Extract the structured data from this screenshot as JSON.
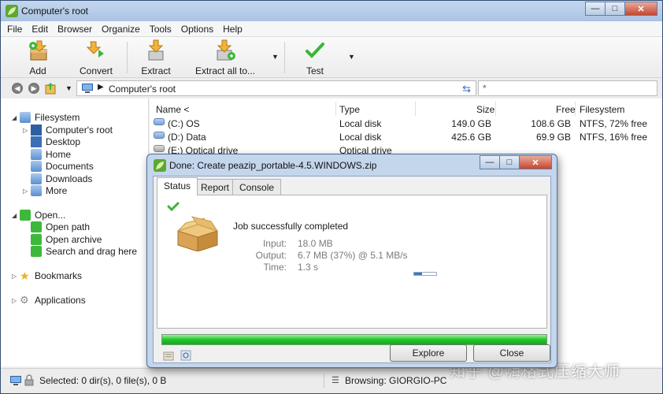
{
  "window": {
    "title": "Computer's root"
  },
  "menu": [
    "File",
    "Edit",
    "Browser",
    "Organize",
    "Tools",
    "Options",
    "Help"
  ],
  "toolbar": {
    "add": "Add",
    "convert": "Convert",
    "extract": "Extract",
    "extract_all": "Extract all to...",
    "test": "Test"
  },
  "address": {
    "path": "Computer's root",
    "filter_placeholder": "*"
  },
  "sidebar": {
    "filesystem": "Filesystem",
    "computers_root": "Computer's root",
    "desktop": "Desktop",
    "home": "Home",
    "documents": "Documents",
    "downloads": "Downloads",
    "more": "More",
    "open": "Open...",
    "open_path": "Open path",
    "open_archive": "Open archive",
    "search_drag": "Search and drag here",
    "bookmarks": "Bookmarks",
    "applications": "Applications"
  },
  "filelist": {
    "columns": {
      "name": "Name <",
      "type": "Type",
      "size": "Size",
      "free": "Free",
      "filesystem": "Filesystem"
    },
    "rows": [
      {
        "name": "(C:) OS",
        "type": "Local disk",
        "size": "149.0 GB",
        "free": "108.6 GB",
        "fs": "NTFS, 72% free"
      },
      {
        "name": "(D:) Data",
        "type": "Local disk",
        "size": "425.6 GB",
        "free": "69.9 GB",
        "fs": "NTFS, 16% free"
      },
      {
        "name": "(E:) Optical drive",
        "type": "Optical drive",
        "size": "",
        "free": "",
        "fs": ""
      }
    ]
  },
  "status": {
    "selected": "Selected: 0 dir(s), 0 file(s), 0 B",
    "browsing": "Browsing: GIORGIO-PC"
  },
  "dialog": {
    "title": "Done: Create peazip_portable-4.5.WINDOWS.zip",
    "tabs": [
      "Status",
      "Report",
      "Console"
    ],
    "message": "Job successfully completed",
    "input_label": "Input:",
    "input_value": "18.0 MB",
    "output_label": "Output:",
    "output_value": "6.7 MB (37%) @ 5.1 MB/s",
    "time_label": "Time:",
    "time_value": "1.3 s",
    "output_ratio": 0.37,
    "progress": 1.0,
    "explore": "Explore",
    "close": "Close"
  },
  "watermark": "知乎 @嗨格式压缩大师",
  "colors": {
    "progress_green": "#22c52a",
    "accent_blue": "#3a78c8"
  }
}
